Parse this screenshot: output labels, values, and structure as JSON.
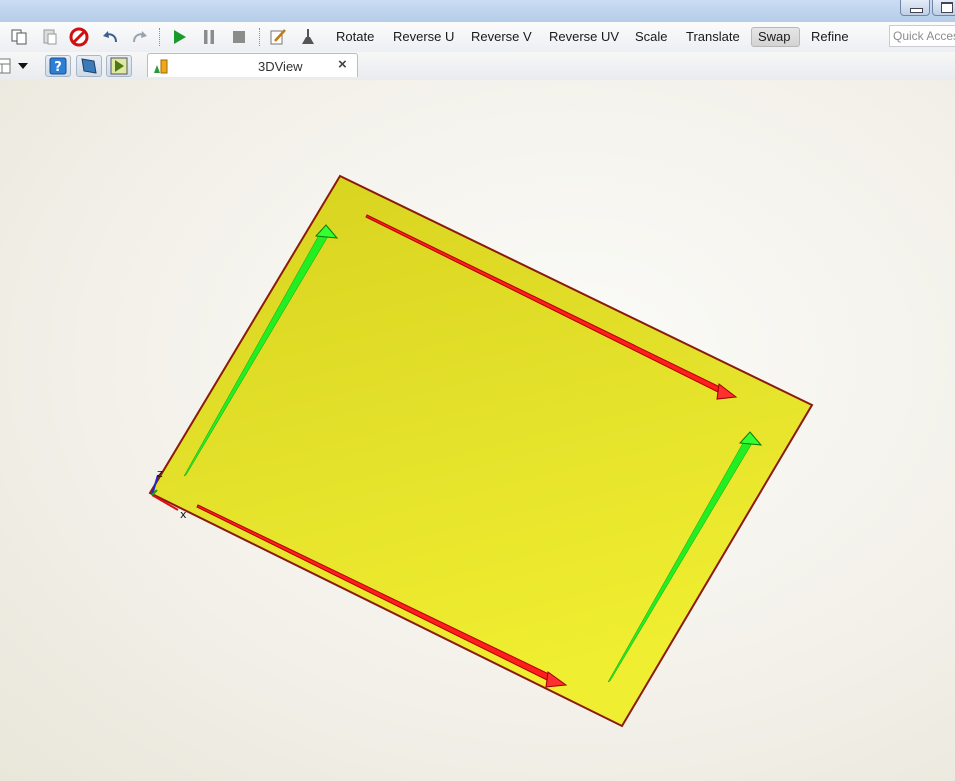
{
  "window": {
    "minimize_icon": "minimize-icon",
    "maximize_icon": "maximize-icon"
  },
  "toolbar": {
    "icons": [
      "copy-icon",
      "paste-icon",
      "cancel-icon",
      "undo-icon",
      "redo-icon",
      "play-icon",
      "pause-icon",
      "stop-icon",
      "edit-icon",
      "funnel-icon"
    ],
    "rotate": "Rotate",
    "reverse_u": "Reverse U",
    "reverse_v": "Reverse V",
    "reverse_uv": "Reverse UV",
    "scale": "Scale",
    "translate": "Translate",
    "swap": "Swap",
    "refine": "Refine",
    "quick_access_placeholder": "Quick Access"
  },
  "secondbar": {
    "icons": [
      "layout-icon",
      "dropdown-arrow-icon",
      "help-icon",
      "surface-icon",
      "play-surface-icon"
    ]
  },
  "tab": {
    "label": "3DView",
    "close": "×",
    "icon": "3dview-chart-icon"
  },
  "viewport": {
    "surface_color": "#e6e42a",
    "edge_color": "#8b1a0e",
    "u_arrow_color": "#ff2020",
    "v_arrow_color": "#22ee22",
    "axis_labels": {
      "x": "x",
      "z": "z"
    }
  }
}
